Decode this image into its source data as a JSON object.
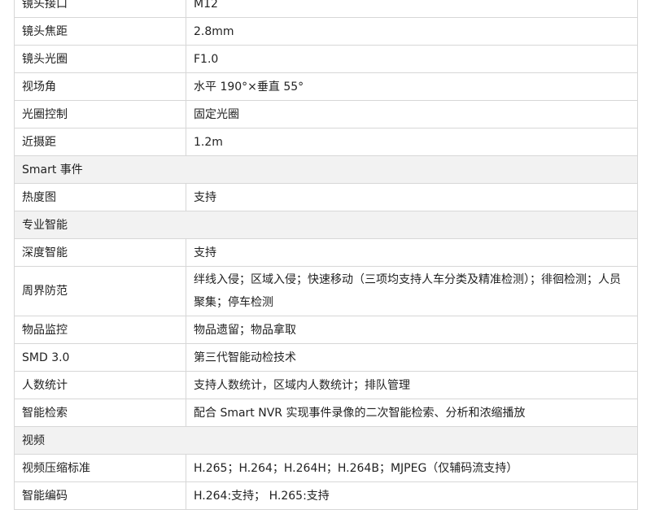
{
  "rows": [
    {
      "type": "row",
      "label": "镜头接口",
      "value": "M12"
    },
    {
      "type": "row",
      "label": "镜头焦距",
      "value": "2.8mm"
    },
    {
      "type": "row",
      "label": "镜头光圈",
      "value": "F1.0"
    },
    {
      "type": "row",
      "label": "视场角",
      "value": "水平 190°×垂直 55°"
    },
    {
      "type": "row",
      "label": "光圈控制",
      "value": "固定光圈"
    },
    {
      "type": "row",
      "label": "近摄距",
      "value": "1.2m"
    },
    {
      "type": "section",
      "label": "Smart 事件"
    },
    {
      "type": "row",
      "label": "热度图",
      "value": "支持"
    },
    {
      "type": "section",
      "label": "专业智能"
    },
    {
      "type": "row",
      "label": "深度智能",
      "value": "支持"
    },
    {
      "type": "row",
      "label": "周界防范",
      "value": "绊线入侵；区域入侵；快速移动（三项均支持人车分类及精准检测）；徘徊检测；人员聚集；停车检测"
    },
    {
      "type": "row",
      "label": "物品监控",
      "value": "物品遗留；物品拿取"
    },
    {
      "type": "row",
      "label": "SMD 3.0",
      "value": "第三代智能动检技术"
    },
    {
      "type": "row",
      "label": "人数统计",
      "value": "支持人数统计，区域内人数统计；排队管理"
    },
    {
      "type": "row",
      "label": "智能检索",
      "value": "配合 Smart NVR 实现事件录像的二次智能检索、分析和浓缩播放"
    },
    {
      "type": "section",
      "label": "视频"
    },
    {
      "type": "row",
      "label": "视频压缩标准",
      "value": "H.265；H.264；H.264H；H.264B；MJPEG（仅辅码流支持）"
    },
    {
      "type": "row",
      "label": "智能编码",
      "value": "H.264:支持； H.265:支持"
    }
  ]
}
